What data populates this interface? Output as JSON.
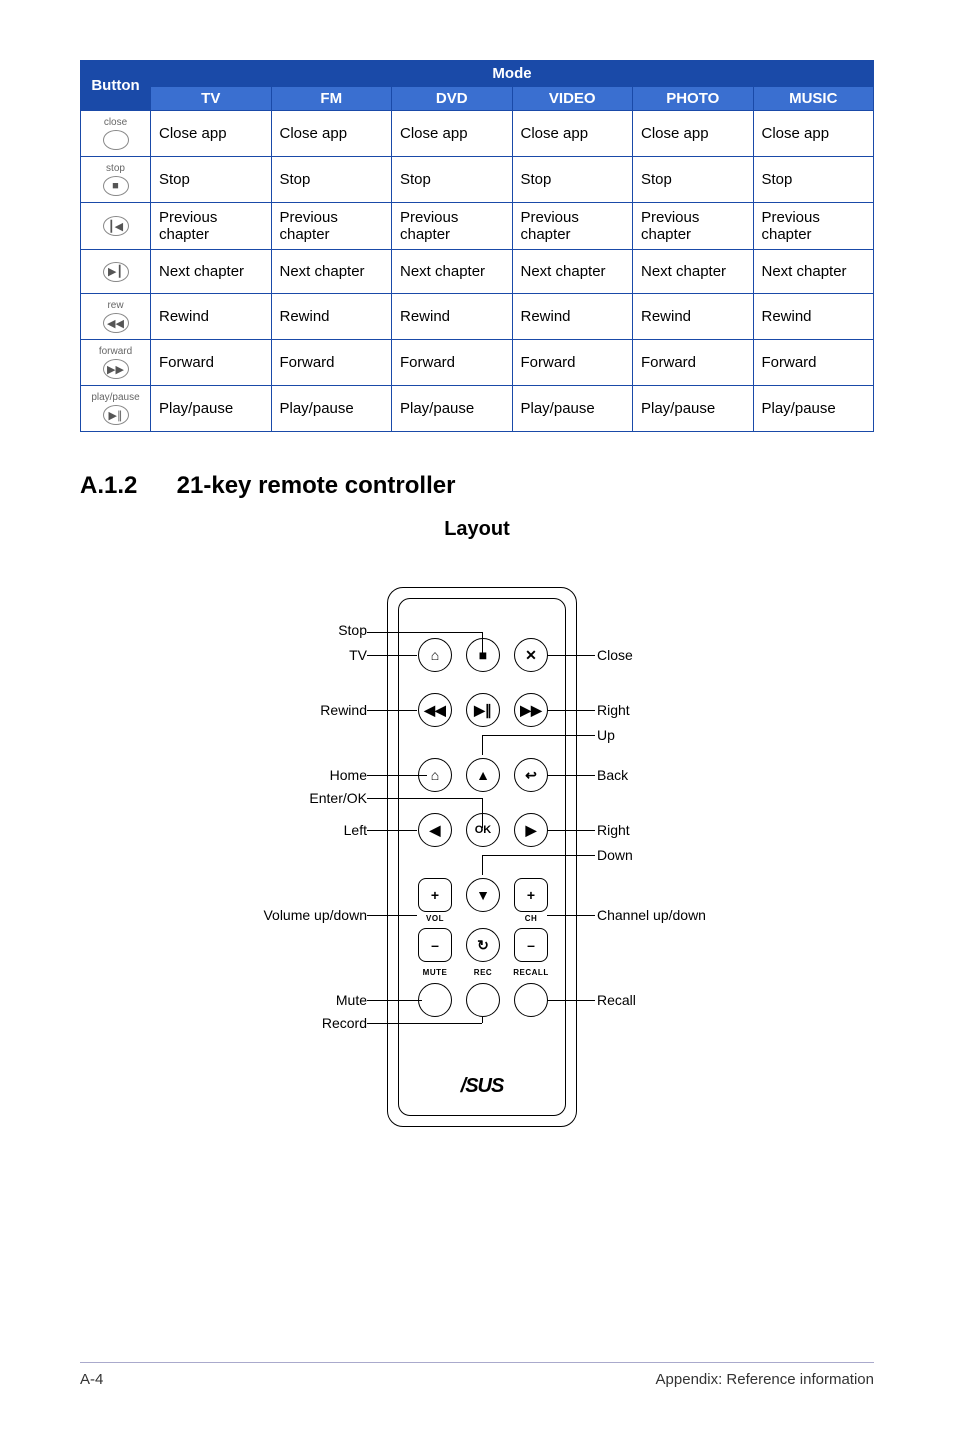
{
  "table": {
    "header_button": "Button",
    "header_mode": "Mode",
    "sub_headers": [
      "TV",
      "FM",
      "DVD",
      "VIDEO",
      "PHOTO",
      "MUSIC"
    ],
    "rows": [
      {
        "btn_label": "close",
        "btn_glyph": "",
        "cells": [
          "Close app",
          "Close app",
          "Close app",
          "Close app",
          "Close app",
          "Close app"
        ]
      },
      {
        "btn_label": "stop",
        "btn_glyph": "■",
        "cells": [
          "Stop",
          "Stop",
          "Stop",
          "Stop",
          "Stop",
          "Stop"
        ]
      },
      {
        "btn_label": "",
        "btn_glyph": "┃◀",
        "cells": [
          "Previous chapter",
          "Previous chapter",
          "Previous chapter",
          "Previous chapter",
          "Previous chapter",
          "Previous chapter"
        ]
      },
      {
        "btn_label": "",
        "btn_glyph": "▶┃",
        "cells": [
          "Next chapter",
          "Next chapter",
          "Next chapter",
          "Next chapter",
          "Next chapter",
          "Next chapter"
        ]
      },
      {
        "btn_label": "rew",
        "btn_glyph": "◀◀",
        "cells": [
          "Rewind",
          "Rewind",
          "Rewind",
          "Rewind",
          "Rewind",
          "Rewind"
        ]
      },
      {
        "btn_label": "forward",
        "btn_glyph": "▶▶",
        "cells": [
          "Forward",
          "Forward",
          "Forward",
          "Forward",
          "Forward",
          "Forward"
        ]
      },
      {
        "btn_label": "play/pause",
        "btn_glyph": "▶∥",
        "cells": [
          "Play/pause",
          "Play/pause",
          "Play/pause",
          "Play/pause",
          "Play/pause",
          "Play/pause"
        ]
      }
    ]
  },
  "section": {
    "number": "A.1.2",
    "title": "21-key remote controller"
  },
  "layout_heading": "Layout",
  "remote": {
    "brand": "/SUS",
    "btn_labels": {
      "mute": "MUTE",
      "rec": "REC",
      "recall": "RECALL",
      "vol": "VOL",
      "ch": "CH",
      "ok": "OK"
    },
    "glyphs": {
      "tv": "⌂",
      "stop": "■",
      "close": "✕",
      "rw": "◀◀",
      "play": "▶∥",
      "ff": "▶▶",
      "home": "⌂",
      "up": "▲",
      "back": "↩",
      "left": "◀",
      "ok": "OK",
      "right": "▶",
      "volp": "+",
      "down": "▼",
      "chp": "+",
      "volm": "–",
      "rot": "↻",
      "chm": "–"
    }
  },
  "callouts": {
    "stop": "Stop",
    "tv": "TV",
    "close": "Close",
    "rewind": "Rewind",
    "right1": "Right",
    "up": "Up",
    "home": "Home",
    "enterok": "Enter/OK",
    "back": "Back",
    "left": "Left",
    "right2": "Right",
    "down": "Down",
    "vol": "Volume up/down",
    "chan": "Channel up/down",
    "mute": "Mute",
    "record": "Record",
    "recall": "Recall"
  },
  "footer": {
    "left": "A-4",
    "right": "Appendix: Reference information"
  }
}
